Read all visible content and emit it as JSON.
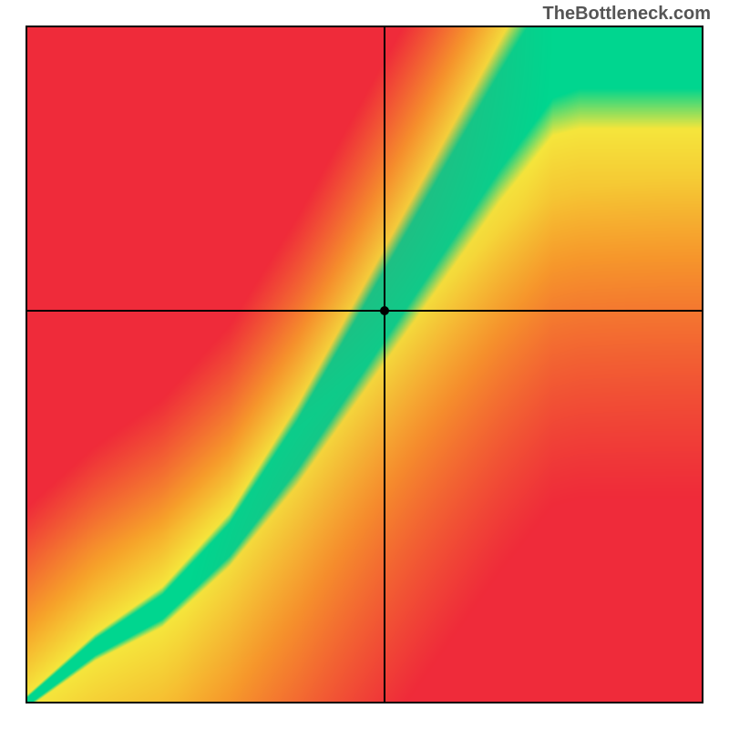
{
  "watermark": "TheBottleneck.com",
  "chart_data": {
    "type": "heatmap",
    "title": "",
    "xlabel": "",
    "ylabel": "",
    "xlim": [
      0,
      100
    ],
    "ylim": [
      0,
      100
    ],
    "marker": {
      "x": 53,
      "y": 58
    },
    "crosshair": {
      "x": 53,
      "y": 58
    },
    "optimal_band": {
      "description": "Narrow green band where GPU and CPU are balanced; surrounded by yellow, fading to orange and red away from the diagonal.",
      "curve": [
        {
          "x": 0,
          "y": 0,
          "width": 1
        },
        {
          "x": 10,
          "y": 8,
          "width": 2
        },
        {
          "x": 20,
          "y": 14,
          "width": 3
        },
        {
          "x": 30,
          "y": 24,
          "width": 4
        },
        {
          "x": 40,
          "y": 38,
          "width": 6
        },
        {
          "x": 45,
          "y": 46,
          "width": 7
        },
        {
          "x": 50,
          "y": 54,
          "width": 8
        },
        {
          "x": 55,
          "y": 62,
          "width": 9
        },
        {
          "x": 60,
          "y": 70,
          "width": 10
        },
        {
          "x": 65,
          "y": 78,
          "width": 11
        },
        {
          "x": 70,
          "y": 86,
          "width": 12
        },
        {
          "x": 78,
          "y": 98,
          "width": 14
        },
        {
          "x": 82,
          "y": 100,
          "width": 15
        }
      ]
    },
    "color_stops": {
      "optimal": "#00d68f",
      "near": "#f5e63c",
      "mid": "#f7a32a",
      "far": "#ef2b3a"
    }
  }
}
